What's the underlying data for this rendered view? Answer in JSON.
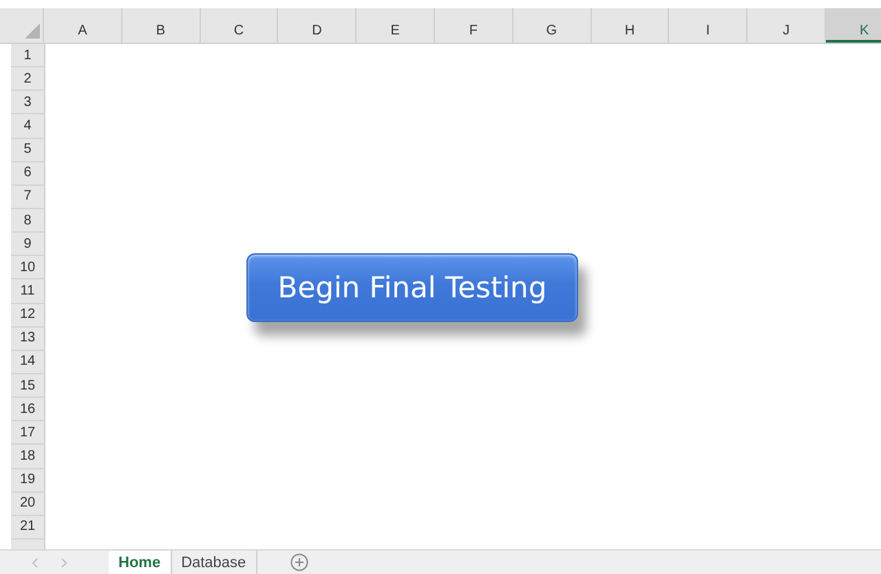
{
  "columns": [
    {
      "label": "A",
      "selected": false
    },
    {
      "label": "B",
      "selected": false
    },
    {
      "label": "C",
      "selected": false
    },
    {
      "label": "D",
      "selected": false
    },
    {
      "label": "E",
      "selected": false
    },
    {
      "label": "F",
      "selected": false
    },
    {
      "label": "G",
      "selected": false
    },
    {
      "label": "H",
      "selected": false
    },
    {
      "label": "I",
      "selected": false
    },
    {
      "label": "J",
      "selected": false
    },
    {
      "label": "K",
      "selected": true
    }
  ],
  "rows": [
    "1",
    "2",
    "3",
    "4",
    "5",
    "6",
    "7",
    "8",
    "9",
    "10",
    "11",
    "12",
    "13",
    "14",
    "15",
    "16",
    "17",
    "18",
    "19",
    "20",
    "21"
  ],
  "button": {
    "label": "Begin Final Testing"
  },
  "sheet_tabs": [
    {
      "label": "Home",
      "selected": true
    },
    {
      "label": "Database",
      "selected": false
    }
  ]
}
